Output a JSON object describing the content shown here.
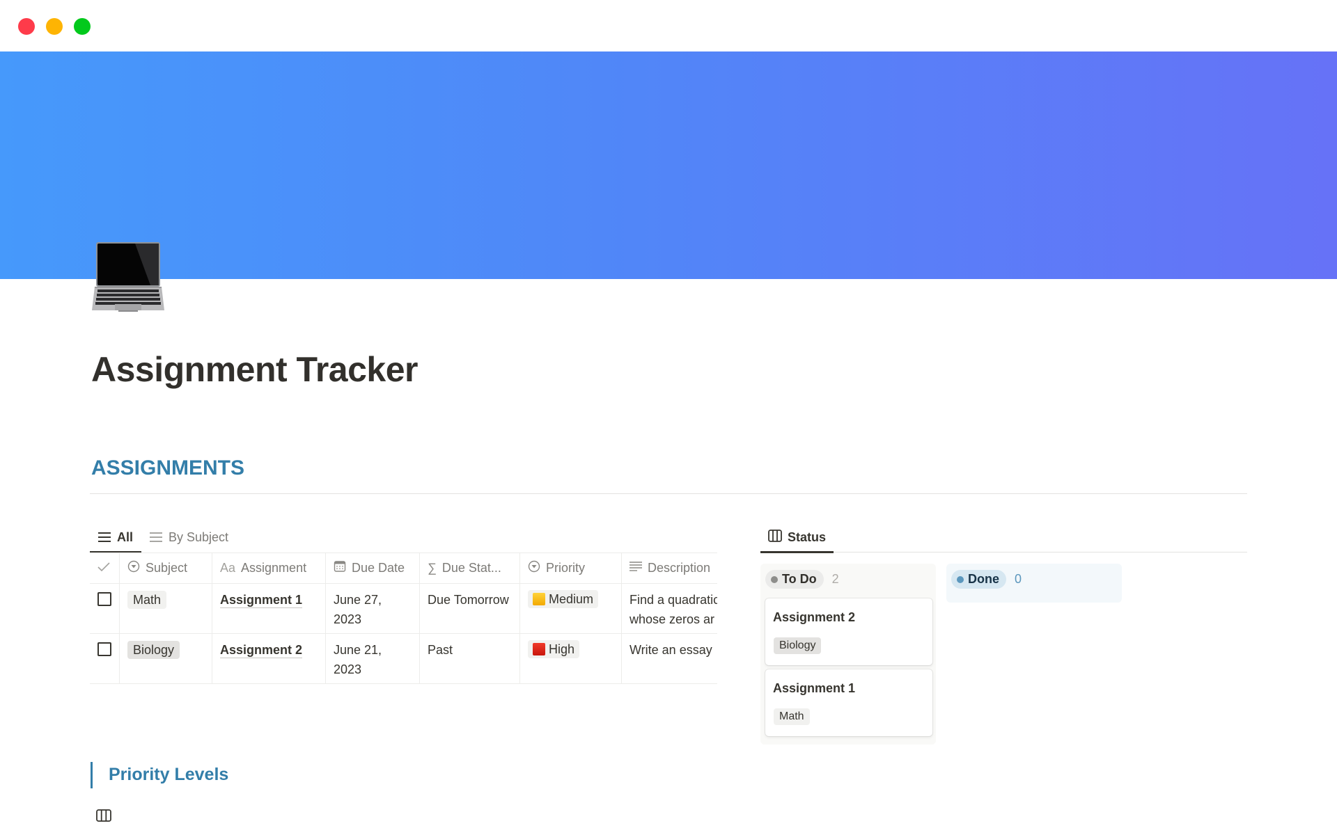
{
  "window": {
    "controls": [
      "close",
      "minimize",
      "zoom"
    ],
    "colors": {
      "close": "#fe3b4a",
      "minimize": "#feb403",
      "zoom": "#02c91c"
    }
  },
  "cover": {
    "gradient_start": "#4699fb",
    "gradient_end": "#6672f7"
  },
  "page": {
    "icon": "laptop-icon",
    "title": "Assignment Tracker"
  },
  "section": {
    "heading": "ASSIGNMENTS",
    "heading_color": "#337ea9"
  },
  "table_view": {
    "tabs": [
      {
        "label": "All",
        "icon": "list-icon",
        "active": true
      },
      {
        "label": "By Subject",
        "icon": "list-icon",
        "active": false
      }
    ],
    "columns": [
      {
        "label": "",
        "icon": "check-icon"
      },
      {
        "label": "Subject",
        "icon": "select-icon"
      },
      {
        "label": "Assignment",
        "icon": "text-icon",
        "icon_text": "Aa"
      },
      {
        "label": "Due Date",
        "icon": "calendar-icon"
      },
      {
        "label": "Due Stat...",
        "icon": "formula-icon",
        "icon_text": "∑"
      },
      {
        "label": "Priority",
        "icon": "select-icon"
      },
      {
        "label": "Description",
        "icon": "lines-icon"
      }
    ],
    "rows": [
      {
        "done": false,
        "subject": "Math",
        "assignment": "Assignment 1",
        "due_date": "June 27, 2023",
        "due_status": "Due Tomorrow",
        "priority": "Medium",
        "priority_color": "#f5b400",
        "description": "Find a quadratic whose zeros ar"
      },
      {
        "done": false,
        "subject": "Biology",
        "assignment": "Assignment 2",
        "due_date": "June 21, 2023",
        "due_status": "Past",
        "priority": "High",
        "priority_color": "#dd2a1b",
        "description": "Write an essay"
      }
    ]
  },
  "board_view": {
    "tab": {
      "label": "Status",
      "icon": "board-icon"
    },
    "columns": [
      {
        "label": "To Do",
        "count": "2",
        "cards": [
          {
            "title": "Assignment 2",
            "tag": "Biology"
          },
          {
            "title": "Assignment 1",
            "tag": "Math"
          }
        ]
      },
      {
        "label": "Done",
        "count": "0",
        "cards": []
      }
    ]
  },
  "priority_levels": {
    "heading": "Priority Levels",
    "icon": "board-icon"
  }
}
